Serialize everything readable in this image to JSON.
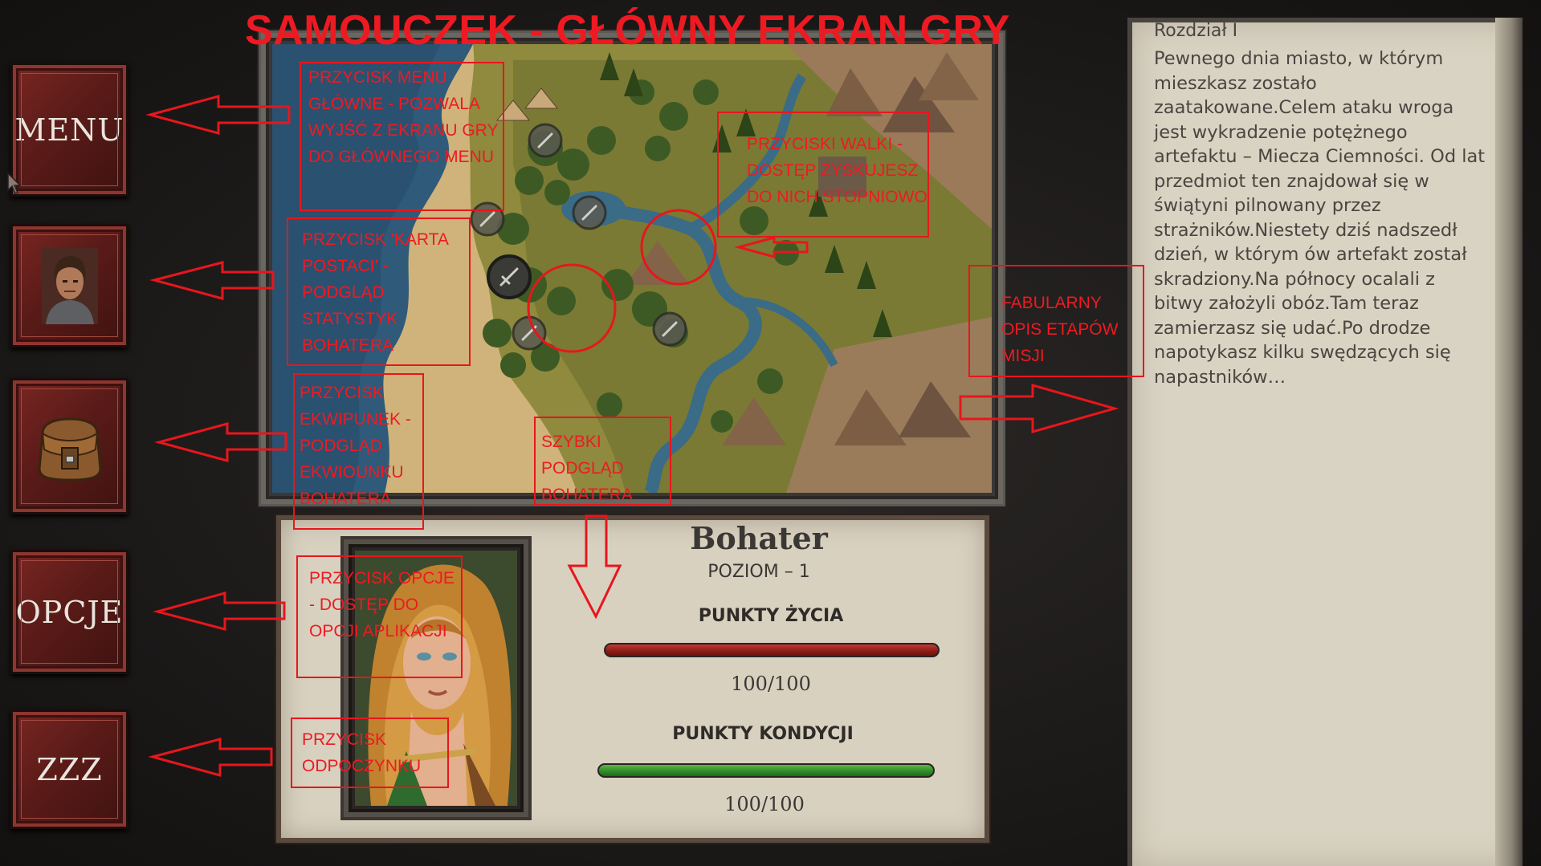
{
  "tutorial_title": "SAMOUCZEK - GŁÓWNY EKRAN GRY",
  "side_buttons": {
    "menu_label": "MENU",
    "options_label": "OPCJE",
    "rest_label": "ZZZ"
  },
  "annotations": {
    "menu": "PRZYCISK MENU GŁÓWNE - POZWALA WYJŚĆ Z EKRANU GRY DO GŁÓWNEGO MENU",
    "character": "PRZYCISK 'KARTA POSTACI' - PODGLĄD STATYSTYK BOHATERA",
    "inventory": "PRZYCISK EKWIPUNEK - PODGLĄD EKWIOUNKU BOHATERA",
    "options": "PRZYCISK OPCJE - DOSTĘP DO OPCJI APLIKACJI",
    "rest": "PRZYCISK ODPOCZYNKU",
    "battle": "PRZYCISKI WALKI - DOSTĘP ZYSKUJESZ DO NICH STOPNIOWO",
    "story": "FABULARNY OPIS ETAPÓW MISJI",
    "hero_preview": "SZYBKI PODGLĄD BOHATERA"
  },
  "hero": {
    "name": "Bohater",
    "level": "POZIOM – 1",
    "hp_label": "PUNKTY ŻYCIA",
    "hp_value": "100/100",
    "hp_fraction": 1.0,
    "stamina_label": "PUNKTY KONDYCJI",
    "stamina_value": "100/100",
    "stamina_fraction": 1.0
  },
  "story": {
    "chapter": "Rozdział I",
    "text": "Pewnego dnia miasto, w którym mieszkasz zostało zaatakowane.Celem ataku wroga jest wykradzenie potężnego artefaktu – Miecza Ciemności. Od lat przedmiot ten znajdował się w świątyni pilnowany przez strażników.Niestety dziś nadszedł dzień, w którym ów artefakt został skradziony.Na północy ocalali z bitwy założyli obóz.Tam teraz zamierzasz się udać.Po drodze napotykasz kilku swędzących się napastników…"
  },
  "icons": {
    "character": "hero-portrait-icon",
    "inventory": "backpack-icon",
    "battle": "sword-icon"
  },
  "colors": {
    "annotation": "#ee1a22",
    "button": "#6a1f1c",
    "hp_bar": "#a32621",
    "stamina_bar": "#3a9a2e"
  }
}
